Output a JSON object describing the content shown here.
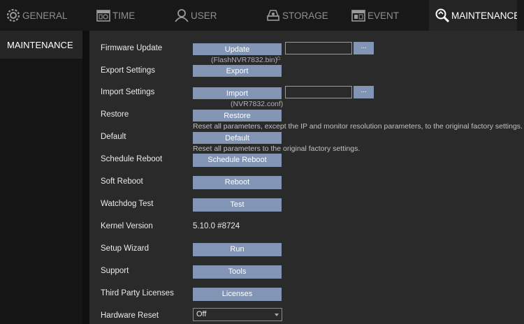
{
  "tabs": [
    {
      "label": "GENERAL",
      "icon": "gear-icon"
    },
    {
      "label": "TIME",
      "icon": "calendar-icon"
    },
    {
      "label": "USER",
      "icon": "user-icon"
    },
    {
      "label": "STORAGE",
      "icon": "storage-icon"
    },
    {
      "label": "EVENT",
      "icon": "event-icon"
    },
    {
      "label": "MAINTENANCE",
      "icon": "maintenance-icon",
      "active": true
    }
  ],
  "sidebar": {
    "items": [
      {
        "label": "MAINTENANCE"
      }
    ]
  },
  "settings": {
    "firmware_update": {
      "label": "Firmware Update",
      "button": "Update",
      "file_hint": "(FlashNVR7832.bin)",
      "browse": "..."
    },
    "export_settings": {
      "label": "Export Settings",
      "button": "Export"
    },
    "import_settings": {
      "label": "Import Settings",
      "button": "Import",
      "file_hint": "(NVR7832.conf)",
      "browse": "..."
    },
    "restore": {
      "label": "Restore",
      "button": "Restore",
      "note": "Reset all parameters, except the IP and monitor resolution parameters, to the original factory settings."
    },
    "default": {
      "label": "Default",
      "button": "Default",
      "note": "Reset all parameters to the original factory settings."
    },
    "schedule_reboot": {
      "label": "Schedule Reboot",
      "button": "Schedule Reboot"
    },
    "soft_reboot": {
      "label": "Soft Reboot",
      "button": "Reboot"
    },
    "watchdog_test": {
      "label": "Watchdog Test",
      "button": "Test"
    },
    "kernel_version": {
      "label": "Kernel Version",
      "value": "5.10.0 #8724"
    },
    "setup_wizard": {
      "label": "Setup Wizard",
      "button": "Run"
    },
    "support": {
      "label": "Support",
      "button": "Tools"
    },
    "third_party_licenses": {
      "label": "Third Party Licenses",
      "button": "Licenses"
    },
    "hardware_reset": {
      "label": "Hardware Reset",
      "selected": "Off"
    }
  },
  "colors": {
    "accent_button": "#8295b4",
    "panel_bg": "#2a2a2a",
    "tabbar_bg": "#181818",
    "active_tab_bg": "#242424"
  }
}
